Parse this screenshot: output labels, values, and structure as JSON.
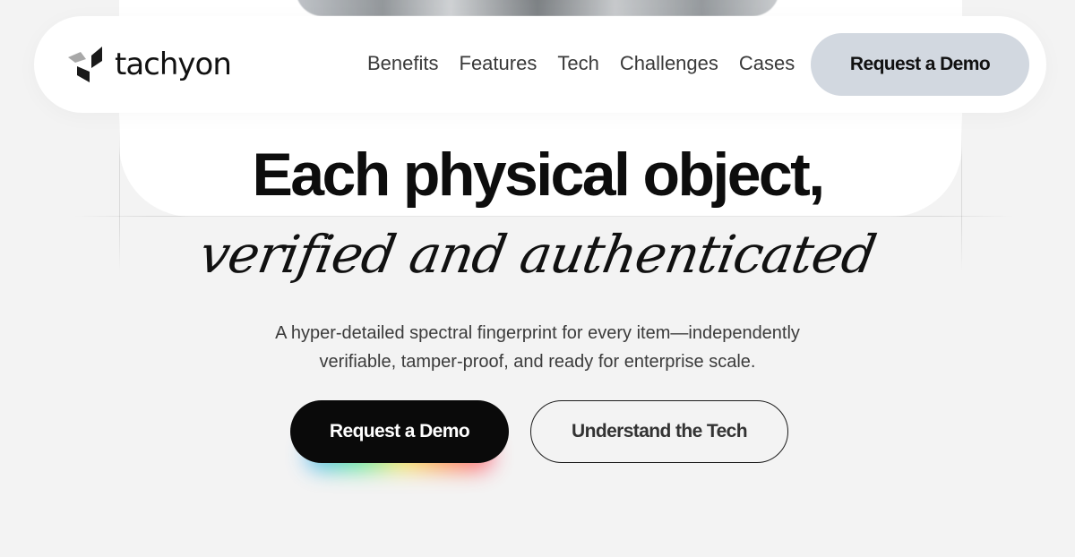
{
  "brand": {
    "name": "tachyon",
    "logo_icon": "tachyon-chevron-logo-icon"
  },
  "nav": {
    "links": [
      "Benefits",
      "Features",
      "Tech",
      "Challenges",
      "Cases"
    ],
    "cta_label": "Request a Demo"
  },
  "hero": {
    "headline": "Each physical object,",
    "script_line": "verified and authenticated",
    "subtext_line1": "A hyper-detailed spectral fingerprint for every item—independently",
    "subtext_line2": "verifiable, tamper-proof, and ready for enterprise scale.",
    "primary_cta": "Request a Demo",
    "secondary_cta": "Understand the Tech"
  },
  "colors": {
    "background": "#f3f3f3",
    "nav_cta_bg": "#d2d8e0",
    "primary_cta_bg": "#0a0a0a",
    "text": "#111111"
  }
}
